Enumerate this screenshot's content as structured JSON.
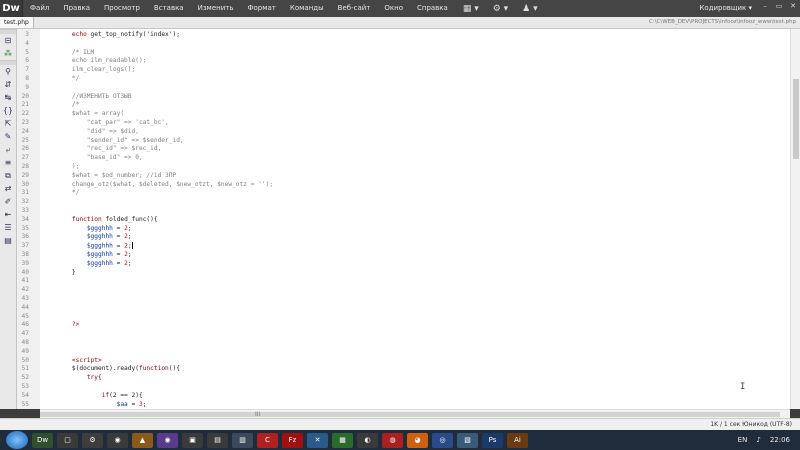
{
  "app": {
    "logo": "Dw"
  },
  "menu": [
    "Файл",
    "Правка",
    "Просмотр",
    "Вставка",
    "Изменить",
    "Формат",
    "Команды",
    "Веб-сайт",
    "Окно",
    "Справка"
  ],
  "toolbar_icons": [
    {
      "name": "layout-icon",
      "glyph": "▦"
    },
    {
      "name": "settings-icon",
      "glyph": "⚙"
    },
    {
      "name": "user-icon",
      "glyph": "♟"
    }
  ],
  "workspace": "Кодировщик ▾",
  "window_controls": {
    "minimize": "–",
    "maximize": "▭",
    "close": "✕"
  },
  "tab": {
    "label": "test.php"
  },
  "filepath": "C:\\C\\WEB_DEV\\PROJECTS\\infooz\\infooz_www\\test.php",
  "code_lines": [
    {
      "n": "3",
      "text": "    echo get_top_notify('index');"
    },
    {
      "n": "4",
      "text": ""
    },
    {
      "n": "5",
      "text": "    /* ILM"
    },
    {
      "n": "6",
      "text": "    echo ilm_readable();"
    },
    {
      "n": "7",
      "text": "    ilm_clear_logs();"
    },
    {
      "n": "8",
      "text": "    */"
    },
    {
      "n": "9",
      "text": ""
    },
    {
      "n": "20",
      "text": "    //ИЗМЕНИТЬ ОТЗЫВ"
    },
    {
      "n": "21",
      "text": "    /*"
    },
    {
      "n": "22",
      "text": "    $what = array("
    },
    {
      "n": "23",
      "text": "        \"cat_par\" => 'cat_bc',"
    },
    {
      "n": "24",
      "text": "        \"did\" => $did,"
    },
    {
      "n": "25",
      "text": "        \"sender_id\" => $sender_id,"
    },
    {
      "n": "26",
      "text": "        \"rec_id\" => $rec_id,"
    },
    {
      "n": "27",
      "text": "        \"base_id\" => 0,"
    },
    {
      "n": "28",
      "text": "    );"
    },
    {
      "n": "29",
      "text": "    $what = $od_number; //id ЗПР"
    },
    {
      "n": "30",
      "text": "    change_otz($what, $deleted, $new_otzt, $new_otz = '');"
    },
    {
      "n": "31",
      "text": "    */"
    },
    {
      "n": "32",
      "text": ""
    },
    {
      "n": "33",
      "text": ""
    },
    {
      "n": "34",
      "text": "    function folded_func(){"
    },
    {
      "n": "35",
      "text": "        $ggghhh = 2;"
    },
    {
      "n": "36",
      "text": "        $ggghhh = 2;"
    },
    {
      "n": "37",
      "text": "        $ggghhh = 2;"
    },
    {
      "n": "38",
      "text": "        $ggghhh = 2;"
    },
    {
      "n": "39",
      "text": "        $ggghhh = 2;"
    },
    {
      "n": "40",
      "text": "    }"
    },
    {
      "n": "41",
      "text": ""
    },
    {
      "n": "42",
      "text": ""
    },
    {
      "n": "43",
      "text": ""
    },
    {
      "n": "44",
      "text": ""
    },
    {
      "n": "45",
      "text": ""
    },
    {
      "n": "46",
      "text": "    ?>"
    },
    {
      "n": "47",
      "text": ""
    },
    {
      "n": "48",
      "text": ""
    },
    {
      "n": "49",
      "text": ""
    },
    {
      "n": "50",
      "text": "    <script>"
    },
    {
      "n": "51",
      "text": "    $(document).ready(function(){"
    },
    {
      "n": "52",
      "text": "        try{"
    },
    {
      "n": "53",
      "text": ""
    },
    {
      "n": "54",
      "text": "            if(2 == 2){"
    },
    {
      "n": "55",
      "text": "                $aa = 3;"
    }
  ],
  "hscroll_grip": "III",
  "status": "1K / 1 сек  Юникод (UTF-8)",
  "taskbar": {
    "apps": [
      "Dw",
      "▢",
      "⚙",
      "◉",
      "▲",
      "◉",
      "▣",
      "▤",
      "▥",
      "C",
      "Fz",
      "✕",
      "▦",
      "◐",
      "◍",
      "◕",
      "◎",
      "▧",
      "Ps",
      "Ai"
    ],
    "lang": "EN",
    "clock": "22:06"
  },
  "colors": {
    "keyword": "#a40000",
    "variable": "#0b3aa8",
    "function_name": "#8b0000",
    "comment": "#808080",
    "string": "#1a1a1a",
    "php_close": "#d40000",
    "tag": "#8b0000"
  }
}
